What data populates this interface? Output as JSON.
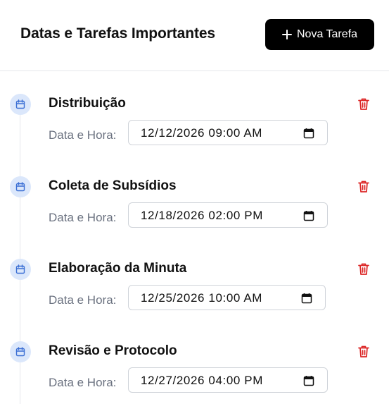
{
  "header": {
    "title": "Datas e Tarefas Importantes",
    "new_task_label": "Nova Tarefa"
  },
  "icons": {
    "task": "calendar-icon",
    "delete": "trash-icon",
    "picker": "calendar-picker-icon",
    "add": "plus-icon"
  },
  "colors": {
    "primary_button": "#000000",
    "icon_bg": "#dbe7fb",
    "icon_fg": "#3b6fd4",
    "delete": "#dc2626",
    "muted_text": "#6b7280"
  },
  "tasks": [
    {
      "title": "Distribuição",
      "datetime_label": "Data e Hora:",
      "datetime_value": "12/12/2026 09:00 AM"
    },
    {
      "title": "Coleta de Subsídios",
      "datetime_label": "Data e Hora:",
      "datetime_value": "12/18/2026 02:00 PM"
    },
    {
      "title": "Elaboração da Minuta",
      "datetime_label": "Data e Hora:",
      "datetime_value": "12/25/2026 10:00 AM"
    },
    {
      "title": "Revisão e Protocolo",
      "datetime_label": "Data e Hora:",
      "datetime_value": "12/27/2026 04:00 PM"
    }
  ]
}
